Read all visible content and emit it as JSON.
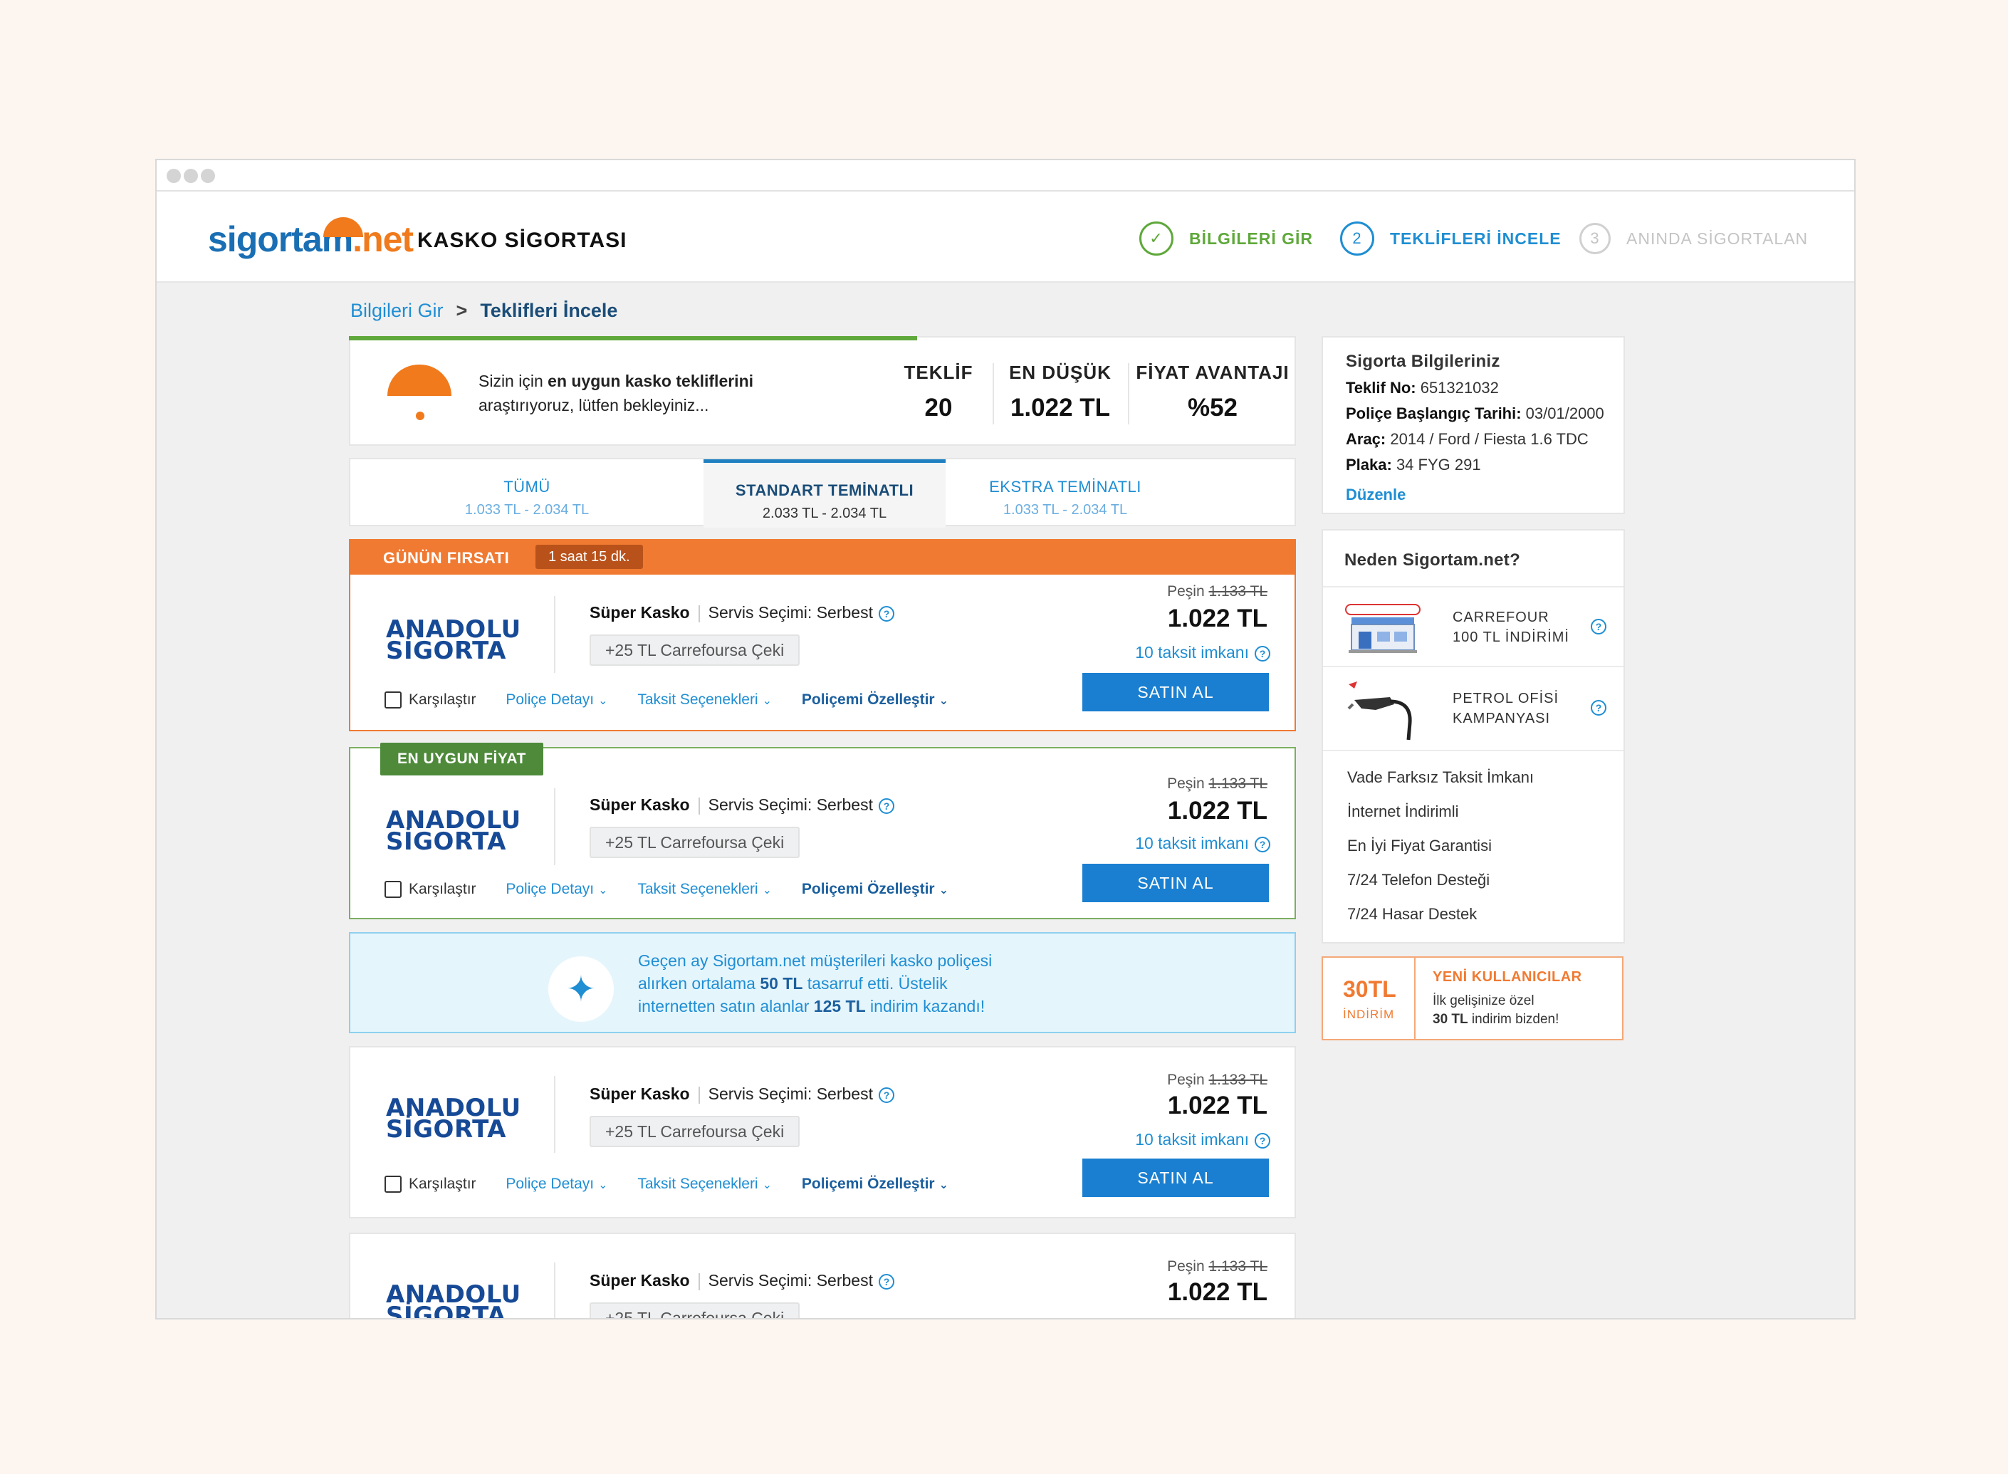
{
  "brand": {
    "logo_part1": "sigortam",
    "logo_part2": ".net",
    "page_title": "KASKO SİGORTASI"
  },
  "steps": [
    {
      "num": "✓",
      "label": "BİLGİLERİ GİR"
    },
    {
      "num": "2",
      "label": "TEKLİFLERİ İNCELE"
    },
    {
      "num": "3",
      "label": "ANINDA SİGORTALAN"
    }
  ],
  "breadcrumb": {
    "first": "Bilgileri Gir",
    "sep": ">",
    "current": "Teklifleri İncele"
  },
  "search_panel": {
    "progress": 0.6,
    "text_prefix": "Sizin için ",
    "text_bold": "en uygun kasko tekliflerini",
    "text_suffix": "araştırıyoruz, lütfen bekleyiniz...",
    "stats": [
      {
        "label": "TEKLİF",
        "value": "20"
      },
      {
        "label": "EN DÜŞÜK",
        "value": "1.022 TL"
      },
      {
        "label": "FİYAT AVANTAJI",
        "value": "%52"
      }
    ]
  },
  "tabs": [
    {
      "title": "TÜMÜ",
      "range": "1.033 TL - 2.034 TL"
    },
    {
      "title": "STANDART TEMİNATLI",
      "range": "2.033 TL - 2.034 TL"
    },
    {
      "title": "EKSTRA TEMİNATLI",
      "range": "1.033 TL - 2.034 TL"
    }
  ],
  "deal": {
    "label": "GÜNÜN FIRSATI",
    "timer": "1 saat 15 dk."
  },
  "offer_common": {
    "brand_line1": "ANADOLU",
    "brand_line2": "SİGORTA",
    "product": "Süper Kasko",
    "service": "Servis Seçimi: Serbest",
    "gift": "+25 TL Carrefoursa Çeki",
    "cash_label": "Peşin",
    "old_price": "1.133 TL",
    "price": "1.022 TL",
    "installment_count": "10",
    "installment_label": "taksit imkanı",
    "buy_label": "SATIN AL",
    "compare_label": "Karşılaştır",
    "link_details": "Poliçe Detayı",
    "link_installments": "Taksit Seçenekleri",
    "link_customize": "Poliçemi Özelleştir"
  },
  "best_price_badge": "EN UYGUN FİYAT",
  "info_banner": {
    "line1": "Geçen ay Sigortam.net müşterileri kasko poliçesi",
    "line2_a": "alırken ortalama ",
    "line2_b": "50 TL",
    "line2_c": " tasarruf etti. Üstelik",
    "line3_a": "internetten satın alanlar ",
    "line3_b": "125 TL",
    "line3_c": " indirim kazandı!"
  },
  "insurance_info": {
    "title": "Sigorta Bilgileriniz",
    "rows": [
      {
        "k": "Teklif No:",
        "v": " 651321032"
      },
      {
        "k": "Poliçe Başlangıç Tarihi:",
        "v": " 03/01/2000"
      },
      {
        "k": "Araç:",
        "v": " 2014 / Ford / Fiesta 1.6 TDC"
      },
      {
        "k": "Plaka:",
        "v": " 34 FYG 291"
      }
    ],
    "edit": "Düzenle"
  },
  "why": {
    "title": "Neden Sigortam.net?",
    "promos": [
      {
        "line1": "CARREFOUR",
        "line2": "100 TL İNDİRİMİ"
      },
      {
        "line1": "PETROL OFİSİ",
        "line2": "KAMPANYASI"
      }
    ],
    "features": [
      "Vade Farksız Taksit İmkanı",
      "İnternet İndirimli",
      "En İyi Fiyat Garantisi",
      "7/24 Telefon Desteği",
      "7/24 Hasar Destek"
    ]
  },
  "discount": {
    "amount": "30TL",
    "amount_label": "İNDİRİM",
    "title": "YENİ KULLANICILAR",
    "line1": "İlk gelişinize özel",
    "line2_bold": "30 TL",
    "line2_rest": " indirim bizden!"
  },
  "colors": {
    "brand_blue": "#1a6fb4",
    "brand_orange": "#f07a1c",
    "success": "#5fa83b",
    "link": "#1f8ed3"
  }
}
